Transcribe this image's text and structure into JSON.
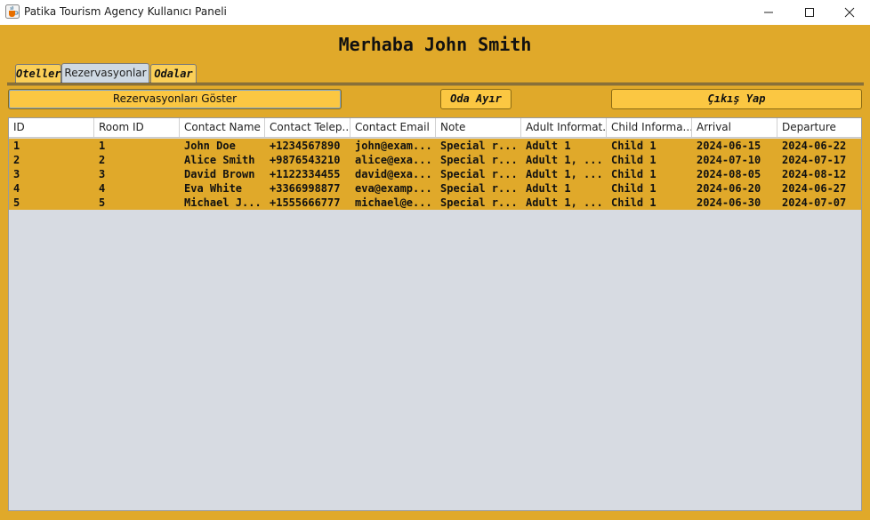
{
  "window": {
    "title": "Patika Tourism Agency Kullanıcı Paneli",
    "icon": "java-cup-icon",
    "accent": "#e0a92a"
  },
  "greeting": "Merhaba John Smith",
  "tabs": [
    {
      "label": "Oteller",
      "active": false
    },
    {
      "label": "Rezervasyonlar",
      "active": true
    },
    {
      "label": "Odalar",
      "active": false
    }
  ],
  "toolbar": {
    "show_reservations": "Rezervasyonları Göster",
    "assign_room": "Oda Ayır",
    "logout": "Çıkış Yap"
  },
  "table": {
    "columns": [
      "ID",
      "Room ID",
      "Contact Name",
      "Contact Telep...",
      "Contact Email",
      "Note",
      "Adult Informat...",
      "Child Informa...",
      "Arrival",
      "Departure"
    ],
    "rows": [
      [
        "1",
        "1",
        "John Doe",
        "+1234567890",
        "john@exam...",
        "Special r...",
        "Adult 1",
        "Child 1",
        "2024-06-15",
        "2024-06-22"
      ],
      [
        "2",
        "2",
        "Alice Smith",
        "+9876543210",
        "alice@exa...",
        "Special r...",
        "Adult 1, ...",
        "Child 1",
        "2024-07-10",
        "2024-07-17"
      ],
      [
        "3",
        "3",
        "David Brown",
        "+1122334455",
        "david@exa...",
        "Special r...",
        "Adult 1, ...",
        "Child 1",
        "2024-08-05",
        "2024-08-12"
      ],
      [
        "4",
        "4",
        "Eva White",
        "+3366998877",
        "eva@examp...",
        "Special r...",
        "Adult 1",
        "Child 1",
        "2024-06-20",
        "2024-06-27"
      ],
      [
        "5",
        "5",
        "Michael J...",
        "+1555666777",
        "michael@e...",
        "Special r...",
        "Adult 1, ...",
        "Child 1",
        "2024-06-30",
        "2024-07-07"
      ]
    ]
  }
}
